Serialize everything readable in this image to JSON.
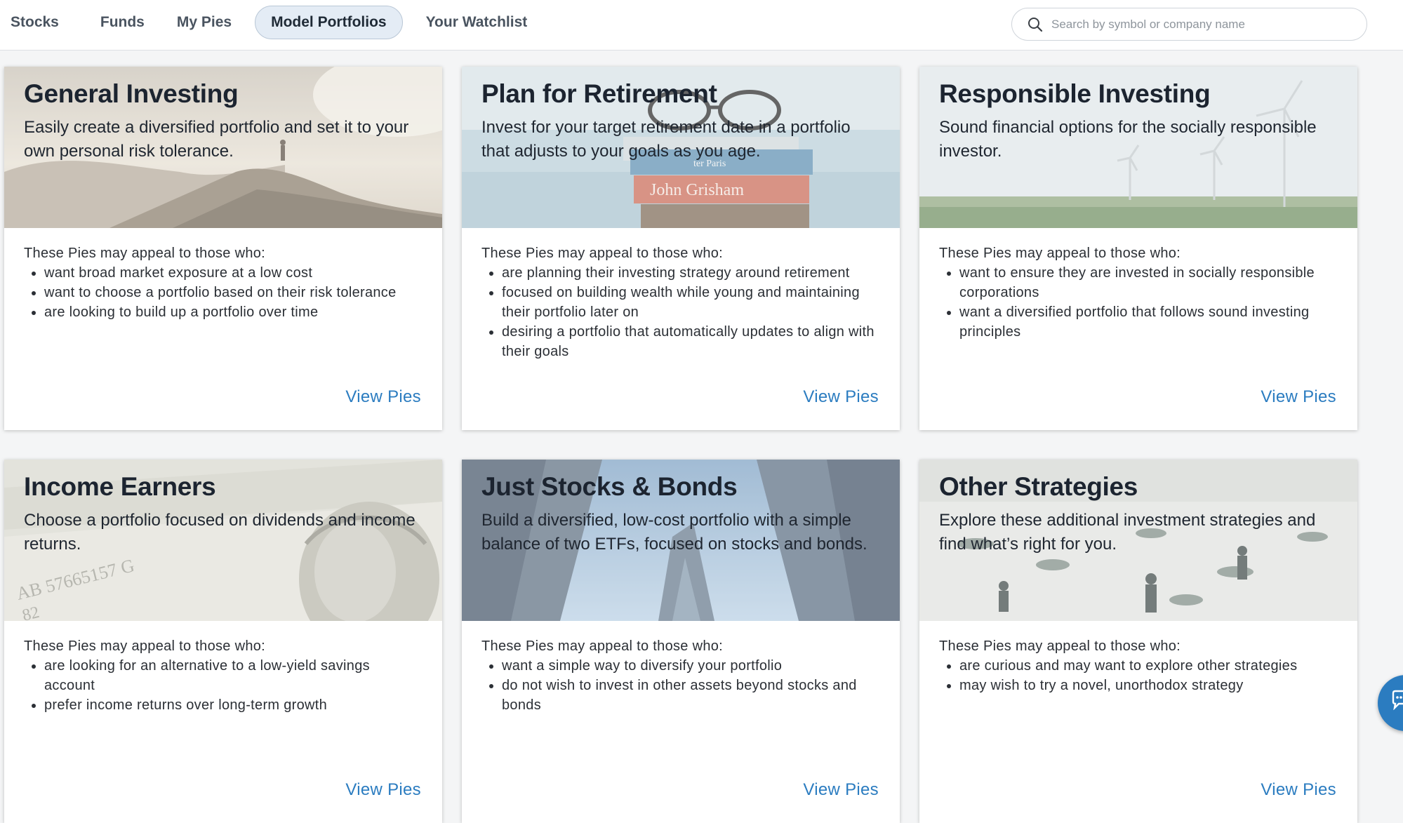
{
  "nav": {
    "tabs": [
      {
        "label": "Stocks"
      },
      {
        "label": "Funds"
      },
      {
        "label": "My Pies"
      },
      {
        "label": "Model Portfolios",
        "active": true
      },
      {
        "label": "Your Watchlist"
      }
    ],
    "search": {
      "placeholder": "Search by symbol or company name",
      "icon": "search-icon"
    }
  },
  "cards": [
    {
      "title": "General Investing",
      "subtitle": "Easily create a diversified portfolio and set it to your own personal risk tolerance.",
      "image": "mountain-hiker-image",
      "lead": "These Pies may appeal to those who:",
      "bullets": [
        "want broad market exposure at a low cost",
        "want to choose a portfolio based on their risk tolerance",
        "are looking to build up a portfolio over time"
      ],
      "link": "View Pies"
    },
    {
      "title": "Plan for Retirement",
      "subtitle": "Invest for your target retirement date in a portfolio that adjusts to your goals as you age.",
      "image": "books-glasses-image",
      "image_text": [
        "John Grisham",
        "ter Paris"
      ],
      "lead": "These Pies may appeal to those who:",
      "bullets": [
        "are planning their investing strategy around retirement",
        "focused on building wealth while young and maintaining their portfolio later on",
        "desiring a portfolio that automatically updates to align with their goals"
      ],
      "link": "View Pies"
    },
    {
      "title": "Responsible Investing",
      "subtitle": "Sound financial options for the socially responsible investor.",
      "image": "wind-turbines-image",
      "lead": "These Pies may appeal to those who:",
      "bullets": [
        "want to ensure they are invested in socially responsible corporations",
        "want a diversified portfolio that follows sound investing principles"
      ],
      "link": "View Pies"
    },
    {
      "title": "Income Earners",
      "subtitle": "Choose a portfolio focused on dividends and income returns.",
      "image": "dollar-bill-image",
      "image_text": [
        "AB 57665157 G",
        "82"
      ],
      "lead": "These Pies may appeal to those who:",
      "bullets": [
        "are looking for an alternative to a low-yield savings account",
        "prefer income returns over long-term growth"
      ],
      "link": "View Pies"
    },
    {
      "title": "Just Stocks & Bonds",
      "subtitle": "Build a diversified, low-cost portfolio with a simple balance of two ETFs, focused on stocks and bonds.",
      "image": "skyscrapers-image",
      "lead": "These Pies may appeal to those who:",
      "bullets": [
        "want a simple way to diversify your portfolio",
        "do not wish to invest in other assets beyond stocks and bonds"
      ],
      "link": "View Pies"
    },
    {
      "title": "Other Strategies",
      "subtitle": "Explore these additional investment strategies and find what’s right for you.",
      "image": "plaza-people-image",
      "lead": "These Pies may appeal to those who:",
      "bullets": [
        "are curious and may want to explore other strategies",
        "may wish to try a novel, unorthodox strategy"
      ],
      "link": "View Pies"
    }
  ],
  "chat": {
    "icon": "chat-icon"
  }
}
